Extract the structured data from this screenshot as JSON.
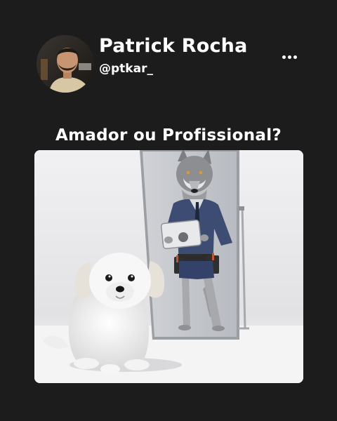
{
  "profile": {
    "display_name": "Patrick Rocha",
    "handle": "@ptkar_",
    "avatar_icon": "person-avatar"
  },
  "actions": {
    "more_icon": "more-horizontal-icon"
  },
  "post": {
    "title": "Amador ou Profissional?",
    "image_icon": "wolf-mirror-dog-illustration"
  },
  "colors": {
    "background": "#1c1c1d",
    "text": "#ffffff"
  }
}
